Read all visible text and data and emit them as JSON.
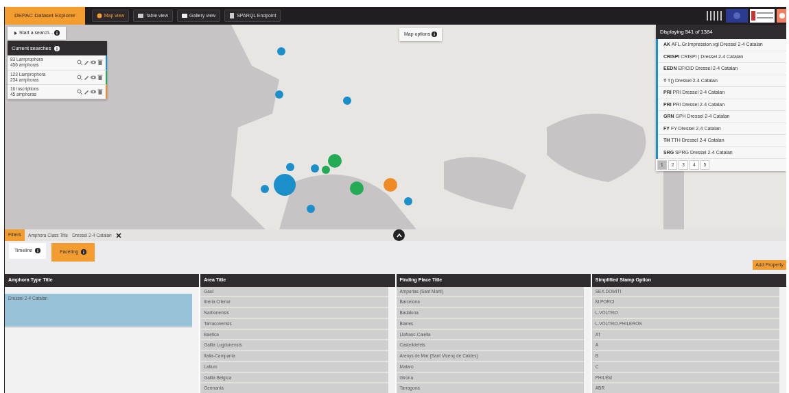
{
  "navbar": {
    "brand": "DEPAC Dataset Explorer",
    "tabs": [
      {
        "label": "Map view",
        "selected": true
      },
      {
        "label": "Table view",
        "selected": false
      },
      {
        "label": "Gallery view",
        "selected": false
      },
      {
        "label": "SPARQL Endpoint",
        "selected": false
      }
    ]
  },
  "search_button": "Start a search...",
  "current_searches": {
    "title": "Current searches",
    "items": [
      {
        "lines": [
          "83 Lamprophora",
          "456 amphoras"
        ],
        "color": "#1a8fc9"
      },
      {
        "lines": [
          "123 Lamprophora",
          "234 amphoras"
        ],
        "color": "#22aa55"
      },
      {
        "lines": [
          "16 inscriptions",
          "45 amphoras"
        ],
        "color": "#f08a24"
      }
    ]
  },
  "map": {
    "options_button": "Map options",
    "markers": [
      {
        "color": "#1a8fc9",
        "kind": "small"
      },
      {
        "color": "#1a8fc9",
        "kind": "small"
      },
      {
        "color": "#1a8fc9",
        "kind": "small"
      },
      {
        "color": "#1a8fc9",
        "kind": "small"
      },
      {
        "color": "#1a8fc9",
        "kind": "small"
      },
      {
        "color": "#22aa55",
        "kind": "small"
      },
      {
        "color": "#22aa55",
        "kind": "medium"
      },
      {
        "color": "#1a8fc9",
        "kind": "small"
      },
      {
        "color": "#1a8fc9",
        "kind": "large"
      },
      {
        "color": "#1a8fc9",
        "kind": "small"
      },
      {
        "color": "#22aa55",
        "kind": "medium"
      },
      {
        "color": "#f08a24",
        "kind": "medium"
      },
      {
        "color": "#1a8fc9",
        "kind": "small"
      }
    ]
  },
  "results": {
    "title": "Displaying 541 of 1384",
    "color": "#1a8fc9",
    "rows": [
      {
        "code": "AK",
        "text": "AFL.Gr.Impression.vgl  Dressel 2-4 Catalan"
      },
      {
        "code": "CRISPI",
        "text": "CRISPI | Dressel 2-4 Catalan"
      },
      {
        "code": "EEDN",
        "text": "EFICID  Dressel 2-4 Catalan"
      },
      {
        "code": "T",
        "text": "T()  Dressel 2-4 Catalan"
      },
      {
        "code": "PRI",
        "text": "PRI  Dressel 2-4 Catalan"
      },
      {
        "code": "PRI",
        "text": "PRI  Dressel 2-4 Catalan"
      },
      {
        "code": "GRN",
        "text": "GPH  Dressel 2-4 Catalan"
      },
      {
        "code": "FY",
        "text": "FY  Dressel 2-4 Catalan"
      },
      {
        "code": "TH",
        "text": "TTH  Dressel 2-4 Catalan"
      },
      {
        "code": "SRG",
        "text": "SPRG  Dressel 2-4 Catalan"
      }
    ],
    "pages": [
      {
        "label": "1",
        "selected": true
      },
      {
        "label": "2",
        "selected": false
      },
      {
        "label": "3",
        "selected": false
      },
      {
        "label": "4",
        "selected": false
      },
      {
        "label": "5",
        "selected": false
      }
    ]
  },
  "filters": {
    "label": "Filters",
    "chips": [
      {
        "field": "Amphora Class Title",
        "value": "Dressel 2-4 Catalan"
      }
    ]
  },
  "panel_tabs": [
    {
      "label": "Timeline",
      "selected": false
    },
    {
      "label": "Faceting",
      "selected": true
    }
  ],
  "add_property": "Add Property",
  "facets": [
    {
      "title": "Amphora Type Title",
      "items": [
        {
          "label": "Dressel 2-4 Catalan",
          "selected": true
        }
      ]
    },
    {
      "title": "Area Title",
      "items": [
        {
          "label": "Gaul",
          "selected": false
        },
        {
          "label": "Iberia Citerior",
          "selected": false
        },
        {
          "label": "Narbonensis",
          "selected": false
        },
        {
          "label": "Tarraconensis",
          "selected": false
        },
        {
          "label": "Baetica",
          "selected": false
        },
        {
          "label": "Gallia Lugdunensis",
          "selected": false
        },
        {
          "label": "Italia-Campania",
          "selected": false
        },
        {
          "label": "Latium",
          "selected": false
        },
        {
          "label": "Gallia Belgica",
          "selected": false
        },
        {
          "label": "Germania",
          "selected": false
        }
      ]
    },
    {
      "title": "Finding Place Title",
      "items": [
        {
          "label": "Ampurias (Sant Martí)",
          "selected": false
        },
        {
          "label": "Barcelona",
          "selected": false
        },
        {
          "label": "Badalona",
          "selected": false
        },
        {
          "label": "Blanes",
          "selected": false
        },
        {
          "label": "Llafranc-Calella",
          "selected": false
        },
        {
          "label": "Castelldefels",
          "selected": false
        },
        {
          "label": "Arenys de Mar (Sant Vicenç de Caldes)",
          "selected": false
        },
        {
          "label": "Mataró",
          "selected": false
        },
        {
          "label": "Girona",
          "selected": false
        },
        {
          "label": "Tarragona",
          "selected": false
        }
      ]
    },
    {
      "title": "Simplified Stamp Option",
      "items": [
        {
          "label": "SEX.DOMITI",
          "selected": false
        },
        {
          "label": "M.PORCI",
          "selected": false
        },
        {
          "label": "L.VOLTEIO",
          "selected": false
        },
        {
          "label": "L.VOLTEIO.PHILEROS",
          "selected": false
        },
        {
          "label": "AT",
          "selected": false
        },
        {
          "label": "A",
          "selected": false
        },
        {
          "label": "B",
          "selected": false
        },
        {
          "label": "C",
          "selected": false
        },
        {
          "label": "PHILEM",
          "selected": false
        },
        {
          "label": "ABR",
          "selected": false
        }
      ]
    }
  ]
}
